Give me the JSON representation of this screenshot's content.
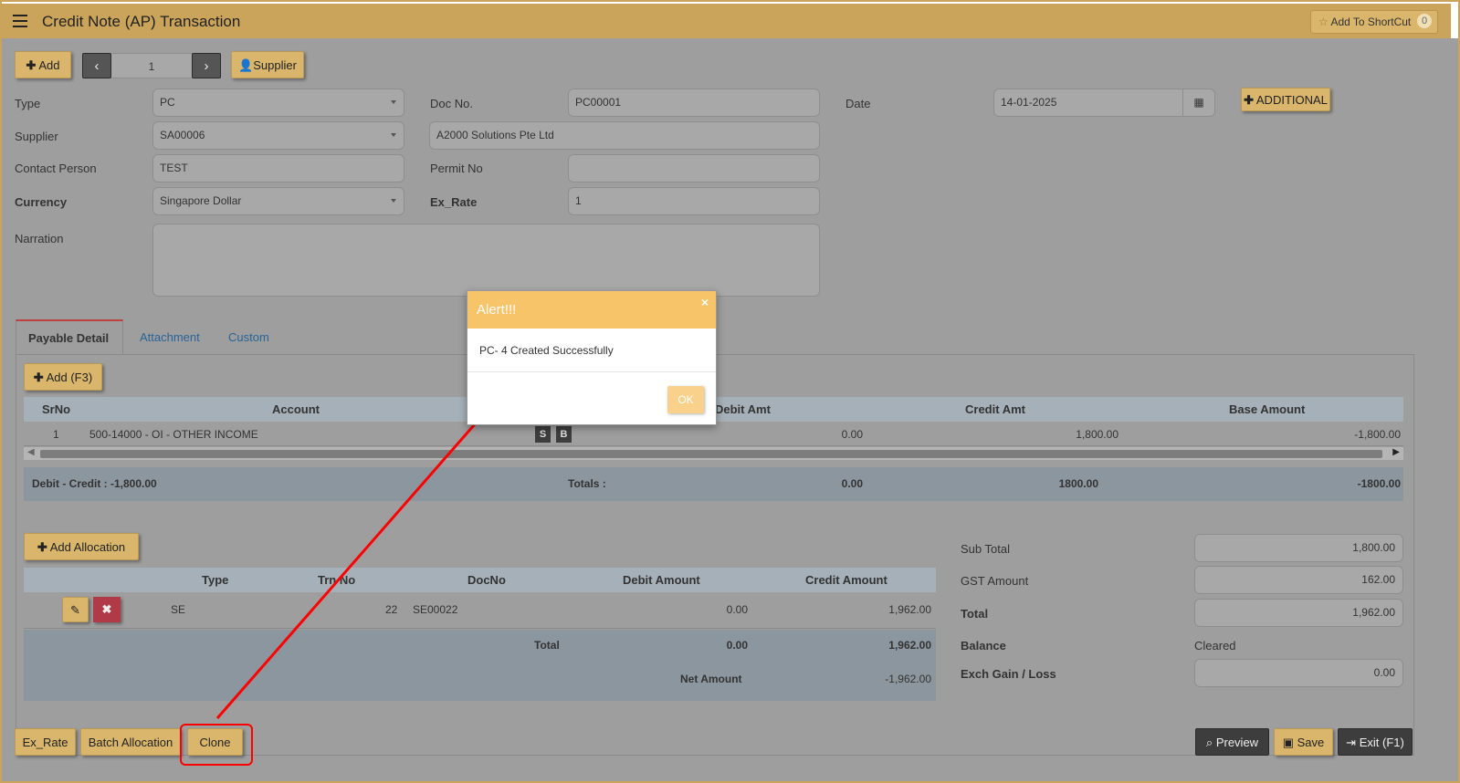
{
  "header": {
    "title": "Credit Note (AP) Transaction",
    "shortcut_label": "Add To ShortCut",
    "shortcut_count": "0"
  },
  "toolbar": {
    "add_label": "Add",
    "record_number": "1",
    "supplier_label": "Supplier",
    "additional_label": "ADDITIONAL"
  },
  "form": {
    "type_label": "Type",
    "type_value": "PC",
    "docno_label": "Doc No.",
    "docno_value": "PC00001",
    "date_label": "Date",
    "date_value": "14-01-2025",
    "supplier_label": "Supplier",
    "supplier_code": "SA00006",
    "supplier_name": "A2000 Solutions Pte Ltd",
    "contact_label": "Contact Person",
    "contact_value": "TEST",
    "permit_label": "Permit No",
    "permit_value": "",
    "currency_label": "Currency",
    "currency_value": "Singapore Dollar",
    "exrate_label": "Ex_Rate",
    "exrate_value": "1",
    "narration_label": "Narration",
    "narration_value": ""
  },
  "tabs": [
    "Payable Detail",
    "Attachment",
    "Custom"
  ],
  "detail": {
    "add_label": "Add (F3)",
    "columns": [
      "SrNo",
      "Account",
      "Debit Amt",
      "Credit Amt",
      "Base Amount"
    ],
    "rows": [
      {
        "srno": "1",
        "account": "500-14000 - OI - OTHER INCOME",
        "debit": "0.00",
        "credit": "1,800.00",
        "base": "-1,800.00"
      }
    ],
    "s_label": "S",
    "b_label": "B",
    "diff_label": "Debit - Credit : -1,800.00",
    "totals_label": "Totals :",
    "total_debit": "0.00",
    "total_credit": "1800.00",
    "total_base": "-1800.00"
  },
  "allocation": {
    "add_label": "Add Allocation",
    "columns": [
      "Type",
      "Trn No",
      "DocNo",
      "Debit Amount",
      "Credit Amount"
    ],
    "rows": [
      {
        "type": "SE",
        "trnno": "22",
        "docno": "SE00022",
        "debit": "0.00",
        "credit": "1,962.00"
      }
    ],
    "total_label": "Total",
    "total_debit": "0.00",
    "total_credit": "1,962.00",
    "net_label": "Net Amount",
    "net_value": "-1,962.00"
  },
  "summary": {
    "subtotal_label": "Sub Total",
    "subtotal_value": "1,800.00",
    "gst_label": "GST Amount",
    "gst_value": "162.00",
    "total_label": "Total",
    "total_value": "1,962.00",
    "balance_label": "Balance",
    "balance_value": "Cleared",
    "exch_label": "Exch Gain / Loss",
    "exch_value": "0.00"
  },
  "footer": {
    "exrate_label": "Ex_Rate",
    "batch_label": "Batch Allocation",
    "clone_label": "Clone",
    "preview_label": "Preview",
    "save_label": "Save",
    "exit_label": "Exit (F1)"
  },
  "alert": {
    "title": "Alert!!!",
    "close": "×",
    "message": "PC- 4 Created Successfully",
    "ok_label": "OK"
  },
  "colors": {
    "header_gold": "#c9a45a",
    "button_gold": "#d9b66b",
    "alert_orange": "#f7c46a",
    "annotation_red": "#ff0000"
  }
}
